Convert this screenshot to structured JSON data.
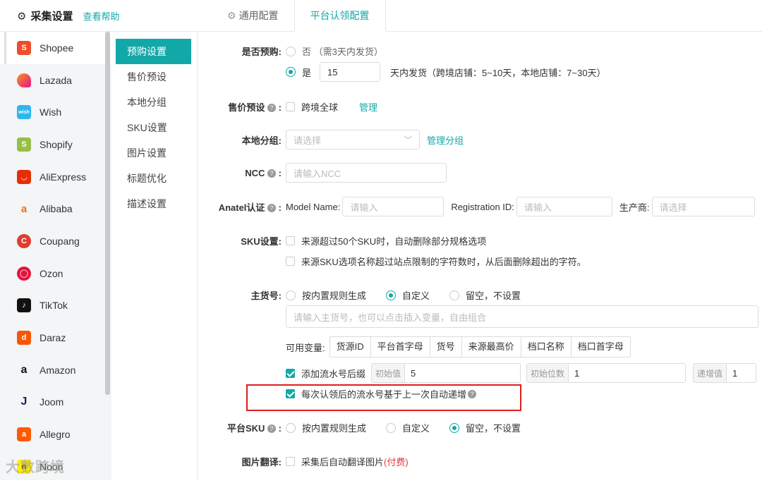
{
  "header": {
    "title": "采集设置",
    "help_link": "查看帮助",
    "tabs": [
      {
        "label": "通用配置",
        "active": false
      },
      {
        "label": "平台认领配置",
        "active": true
      }
    ]
  },
  "sidebar": {
    "items": [
      {
        "label": "Shopee",
        "icon": "shopee-icon",
        "active": true
      },
      {
        "label": "Lazada",
        "icon": "lazada-icon"
      },
      {
        "label": "Wish",
        "icon": "wish-icon"
      },
      {
        "label": "Shopify",
        "icon": "shopify-icon"
      },
      {
        "label": "AliExpress",
        "icon": "aliexpress-icon"
      },
      {
        "label": "Alibaba",
        "icon": "alibaba-icon"
      },
      {
        "label": "Coupang",
        "icon": "coupang-icon"
      },
      {
        "label": "Ozon",
        "icon": "ozon-icon"
      },
      {
        "label": "TikTok",
        "icon": "tiktok-icon"
      },
      {
        "label": "Daraz",
        "icon": "daraz-icon"
      },
      {
        "label": "Amazon",
        "icon": "amazon-icon"
      },
      {
        "label": "Joom",
        "icon": "joom-icon"
      },
      {
        "label": "Allegro",
        "icon": "allegro-icon"
      },
      {
        "label": "Noon",
        "icon": "noon-icon"
      }
    ]
  },
  "subnav": {
    "items": [
      "预购设置",
      "售价预设",
      "本地分组",
      "SKU设置",
      "图片设置",
      "标题优化",
      "描述设置"
    ]
  },
  "form": {
    "preorder": {
      "label": "是否预购:",
      "no_label": "否 （需3天内发货）",
      "yes_label": "是",
      "days_value": "15",
      "days_suffix": "天内发货（跨境店铺：5~10天，本地店铺：7~30天）"
    },
    "price": {
      "label": "售价预设",
      "option": "跨境全球",
      "manage": "管理"
    },
    "group": {
      "label": "本地分组:",
      "placeholder": "请选择",
      "manage": "管理分组"
    },
    "ncc": {
      "label": "NCC",
      "placeholder": "请输入NCC"
    },
    "anatel": {
      "label": "Anatel认证",
      "model_label": "Model Name:",
      "model_placeholder": "请输入",
      "reg_label": "Registration ID:",
      "reg_placeholder": "请输入",
      "maker_label": "生产商:",
      "maker_placeholder": "请选择"
    },
    "sku": {
      "label": "SKU设置:",
      "opt1": "来源超过50个SKU时，自动删除部分规格选项",
      "opt2": "来源SKU选项名称超过站点限制的字符数时，从后面删除超出的字符。"
    },
    "main_sku": {
      "label": "主货号:",
      "opt_rule": "按内置规则生成",
      "opt_custom": "自定义",
      "opt_empty": "留空，不设置",
      "input_placeholder": "请输入主货号，也可以点击插入变量，自由组合",
      "vars_label": "可用变量:",
      "vars": [
        "货源ID",
        "平台首字母",
        "货号",
        "来源最高价",
        "档口名称",
        "档口首字母"
      ],
      "serial_label": "添加流水号后缀",
      "start_label": "初始值",
      "start_value": "5",
      "digits_label": "初始位数",
      "digits_value": "1",
      "inc_label": "递增值",
      "inc_value": "1",
      "auto_inc_label": "每次认领后的流水号基于上一次自动递增"
    },
    "platform_sku": {
      "label": "平台SKU",
      "opt_rule": "按内置规则生成",
      "opt_custom": "自定义",
      "opt_empty": "留空，不设置"
    },
    "image_translate": {
      "label": "图片翻译:",
      "option": "采集后自动翻译图片",
      "paid": "(付费)"
    }
  },
  "watermark": "大数跨境",
  "colors": {
    "accent": "#13a8a8",
    "highlight": "#e01d1d"
  }
}
